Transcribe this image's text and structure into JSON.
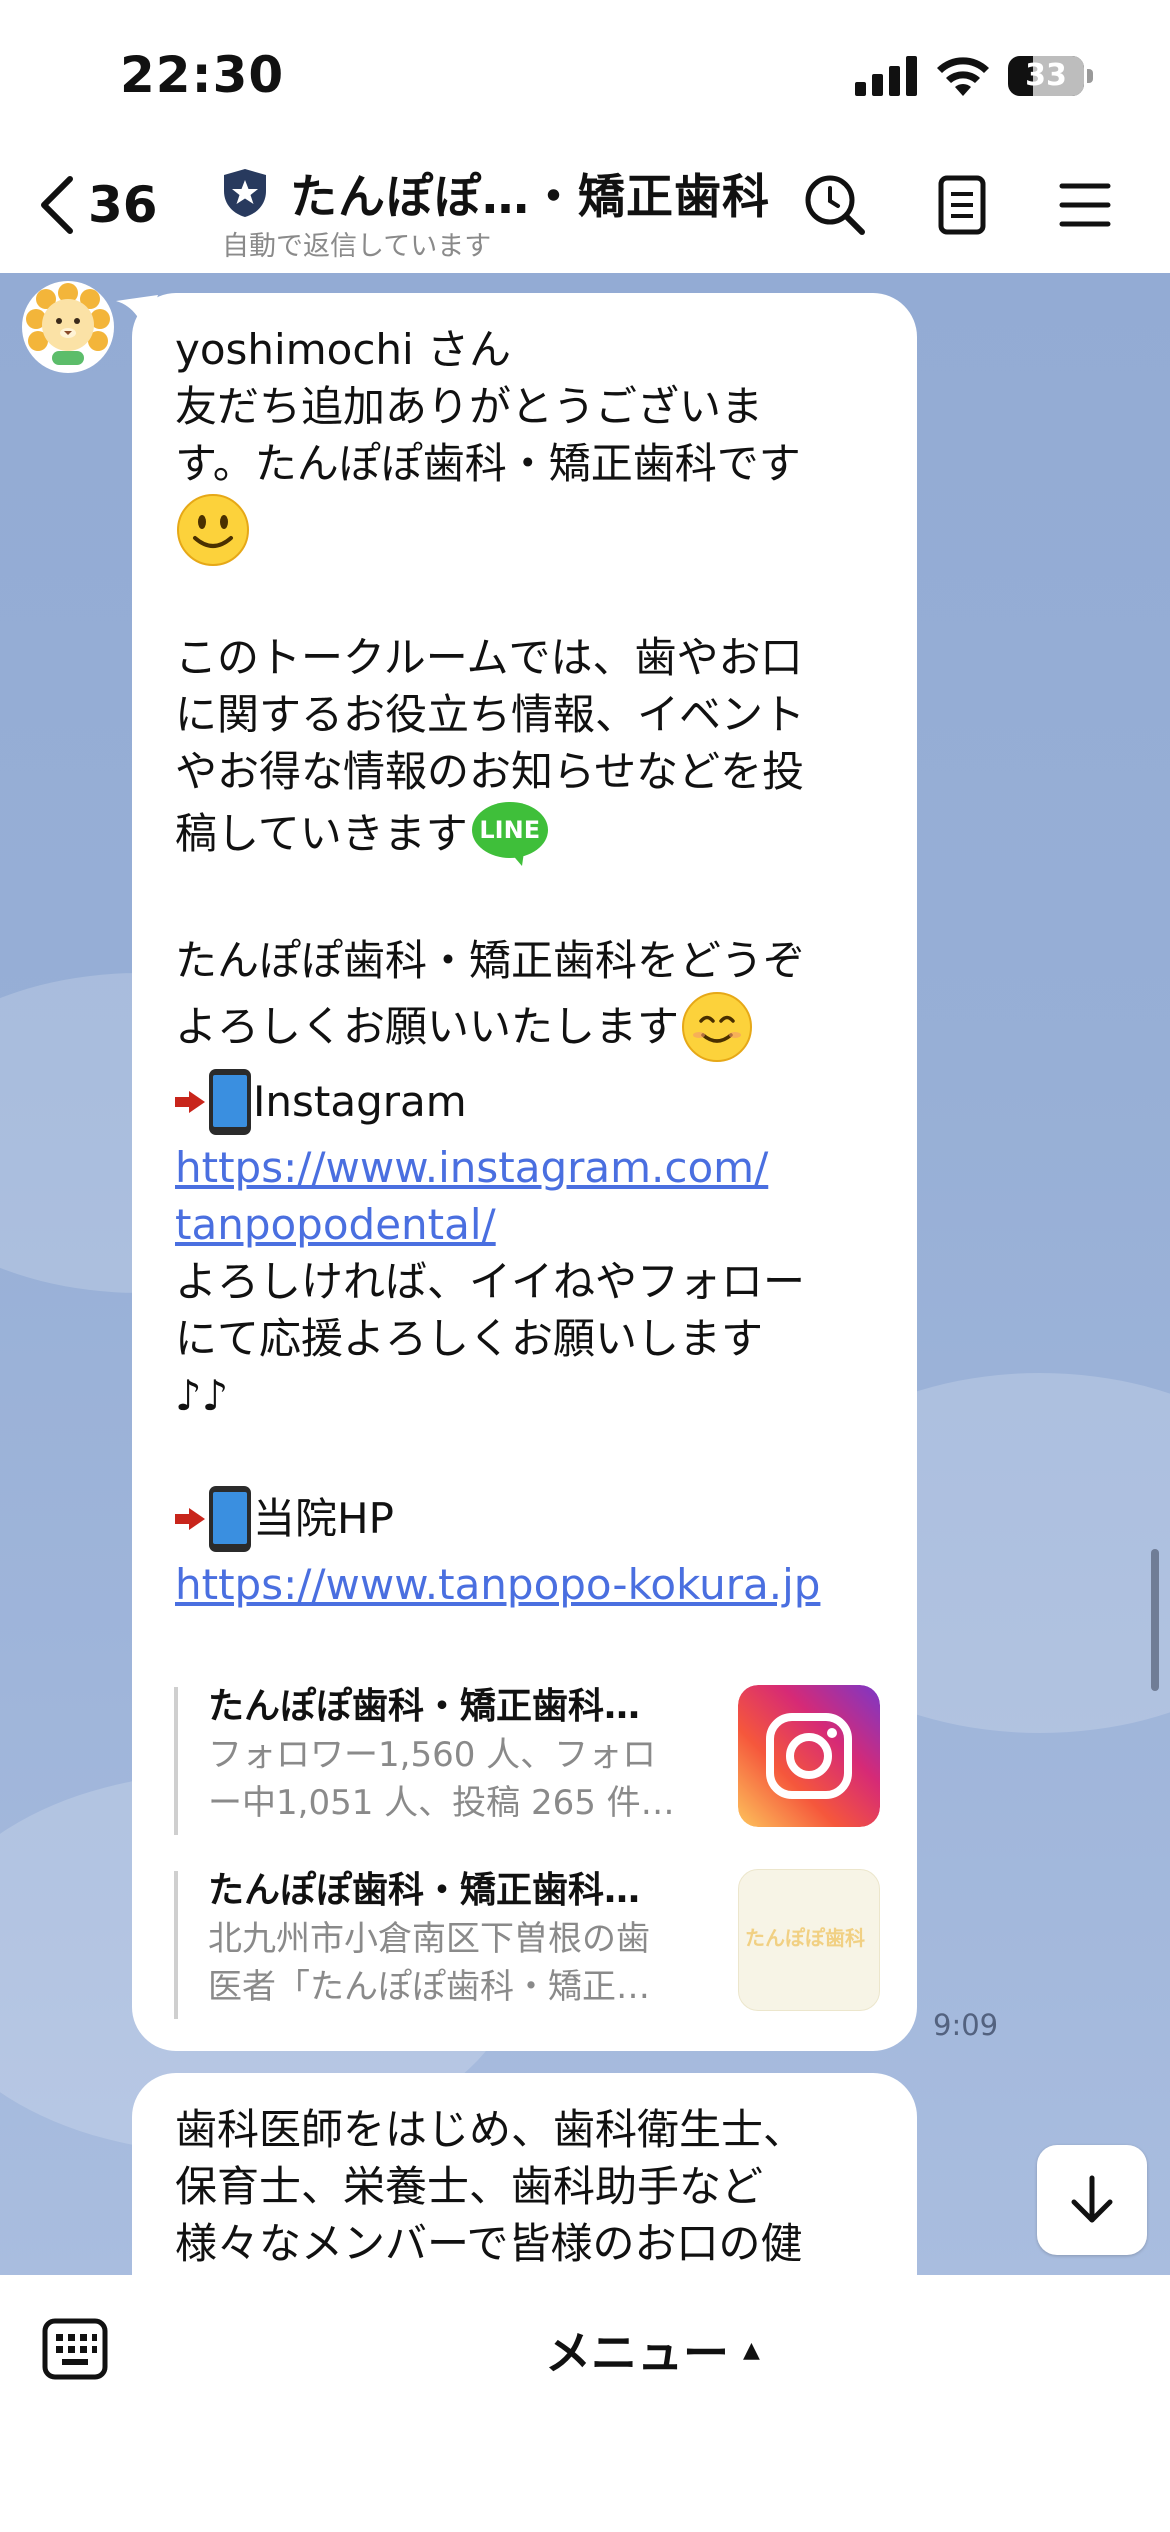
{
  "status": {
    "time": "22:30",
    "battery": "33",
    "battery_level": 0.33
  },
  "header": {
    "unread_count": "36",
    "title": "たんぽぽ…・矯正歯科",
    "subtitle": "自動で返信しています",
    "icons": [
      "back-chevron-icon",
      "shield-icon",
      "search-icon",
      "notes-icon",
      "menu-icon"
    ]
  },
  "messages": [
    {
      "lines": {
        "l1": "yoshimochi さん",
        "l2": "友だち追加ありがとうございま",
        "l3": "す。たんぽぽ歯科・矯正歯科です",
        "l5": "このトークルームでは、歯やお口",
        "l6": "に関するお役立ち情報、イベント",
        "l7": "やお得な情報のお知らせなどを投",
        "l8": "稿していきます",
        "l9": "たんぽぽ歯科・矯正歯科をどうぞ",
        "l10": "よろしくお願いいたします",
        "l11": "Instagram",
        "l12": "https://www.instagram.com/",
        "l13": "tanpopodental/",
        "l14": "よろしければ、イイねやフォロー",
        "l15": "にて応援よろしくお願いします",
        "l16": "♪♪",
        "l17": "当院HP",
        "l18": "https://www.tanpopo-kokura.jp"
      },
      "line_badge": "LINE",
      "previews": [
        {
          "title": "たんぽぽ歯科・矯正歯科…",
          "desc1": "フォロワー1,560 人、フォロ",
          "desc2": "ー中1,051 人、投稿 265 件…"
        },
        {
          "title": "たんぽぽ歯科・矯正歯科…",
          "desc1": "北九州市小倉南区下曽根の歯",
          "desc2": "医者「たんぽぽ歯科・矯正…",
          "thumb_text": "たんぽぽ歯科"
        }
      ],
      "time": "9:09"
    },
    {
      "lines": {
        "l1": "歯科医師をはじめ、歯科衛生士、",
        "l2": "保育士、栄養士、歯科助手など",
        "l3": "様々なメンバーで皆様のお口の健"
      }
    }
  ],
  "bottom": {
    "menu_label": "メニュー",
    "menu_arrow": "▲"
  },
  "colors": {
    "chat_bg": "#95acd5",
    "link": "#4a6fe0",
    "line_green": "#3fbf3a"
  }
}
